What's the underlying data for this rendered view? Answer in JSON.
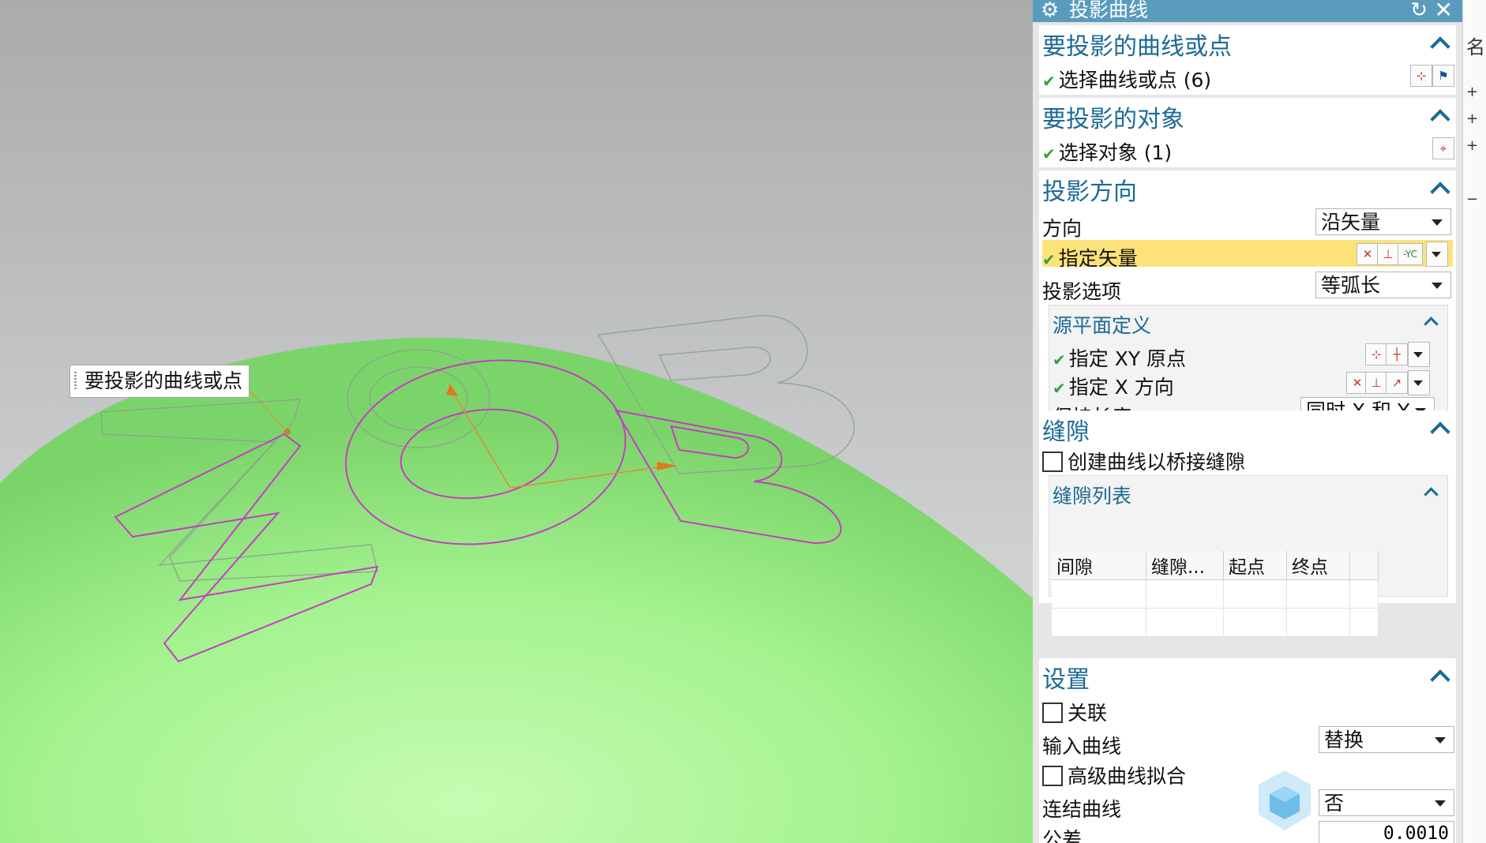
{
  "tooltip": {
    "text": "要投影的曲线或点"
  },
  "dialog": {
    "title": "投影曲线",
    "sections": {
      "curves": {
        "header": "要投影的曲线或点",
        "select_label": "选择曲线或点 (6)"
      },
      "objects": {
        "header": "要投影的对象",
        "select_label": "选择对象 (1)"
      },
      "direction": {
        "header": "投影方向",
        "direction_label": "方向",
        "direction_value": "沿矢量",
        "vector_label": "指定矢量",
        "vector_badge": "-YC",
        "option_label": "投影选项",
        "option_value": "等弧长",
        "source_plane": {
          "header": "源平面定义",
          "xy_origin_label": "指定 XY 原点",
          "x_dir_label": "指定 X 方向",
          "keep_length_label": "保持长度",
          "keep_length_value": "同时 X 和 Y"
        }
      },
      "gaps": {
        "header": "缝隙",
        "bridge_label": "创建曲线以桥接缝隙",
        "list_header": "缝隙列表",
        "columns": [
          "间隙",
          "缝隙...",
          "起点",
          "终点",
          ""
        ]
      },
      "settings": {
        "header": "设置",
        "associative_label": "关联",
        "input_curve_label": "输入曲线",
        "input_curve_value": "替换",
        "advanced_fit_label": "高级曲线拟合",
        "join_label": "连结曲线",
        "join_value": "否",
        "tolerance_label": "公差",
        "tolerance_value": "0.0010"
      }
    }
  },
  "right_strip": {
    "top_char": "名",
    "markers": [
      "+",
      "+",
      "+",
      "−"
    ]
  },
  "colors": {
    "title_bar": "#5a9bbd",
    "accent": "#1b6a95",
    "surface": "#8fe27c",
    "projected_curve": "#c43ec4",
    "highlight": "#fde27a"
  }
}
